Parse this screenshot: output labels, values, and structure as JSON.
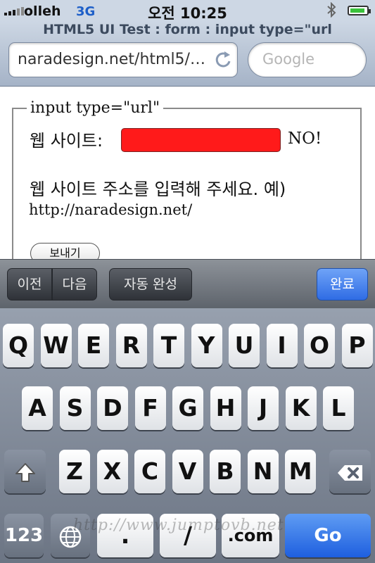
{
  "status_bar": {
    "carrier": "olleh",
    "network": "3G",
    "time": "오전 10:25",
    "bluetooth_icon": "bluetooth-icon",
    "battery_icon": "battery-icon",
    "battery_level": 0.9,
    "battery_color": "#3bc23b"
  },
  "browser": {
    "page_title": "HTML5 UI Test : form : input type=\"url",
    "url": "naradesign.net/html5/f...",
    "reload_icon": "reload-icon",
    "search_placeholder": "Google"
  },
  "form": {
    "legend": "input type=\"url\"",
    "label": "웹 사이트:",
    "input_value": "",
    "input_color": "#ff1a1a",
    "validation": "NO!",
    "help_line1": "웹 사이트 주소를 입력해 주세요. 예)",
    "help_line2": "http://naradesign.net/",
    "submit_label": "보내기"
  },
  "form_assistant": {
    "prev": "이전",
    "next": "다음",
    "autofill": "자동 완성",
    "done": "완료"
  },
  "keyboard": {
    "row1": [
      "Q",
      "W",
      "E",
      "R",
      "T",
      "Y",
      "U",
      "I",
      "O",
      "P"
    ],
    "row2": [
      "A",
      "S",
      "D",
      "F",
      "G",
      "H",
      "J",
      "K",
      "L"
    ],
    "row3": [
      "Z",
      "X",
      "C",
      "V",
      "B",
      "N",
      "M"
    ],
    "shift_icon": "shift-icon",
    "backspace_icon": "backspace-icon",
    "numbers": "123",
    "globe_icon": "globe-icon",
    "dot": ".",
    "slash": "/",
    "dotcom": ".com",
    "go": "Go"
  },
  "watermark": "http://www.jumptovb.net"
}
